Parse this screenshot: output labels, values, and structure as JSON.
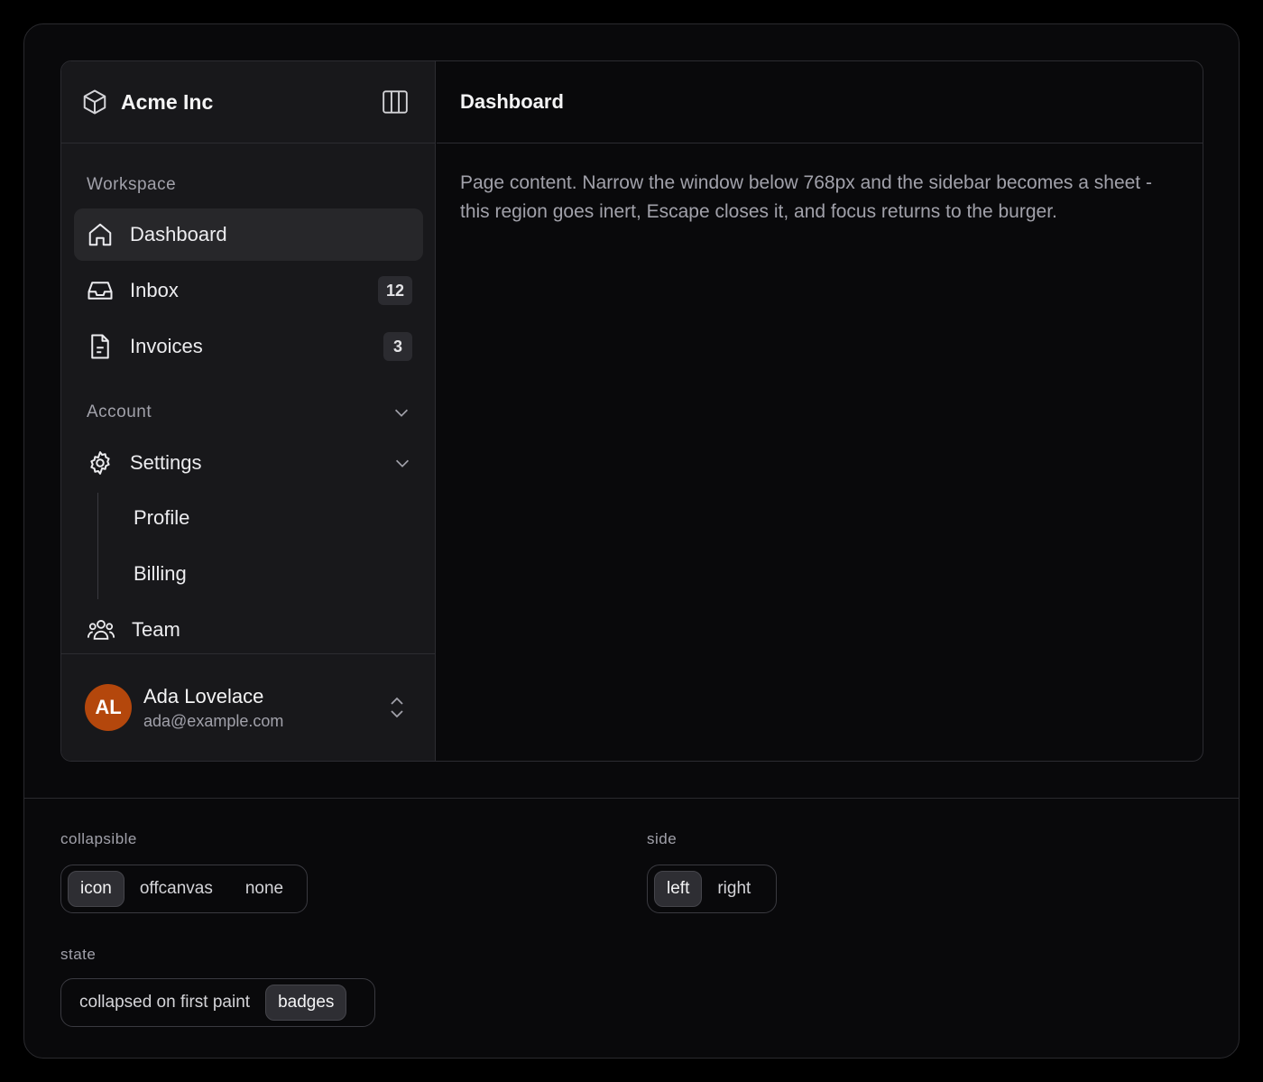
{
  "sidebar": {
    "brand": "Acme Inc",
    "workspace_label": "Workspace",
    "items": [
      {
        "label": "Dashboard",
        "icon": "home-icon"
      },
      {
        "label": "Inbox",
        "icon": "inbox-icon",
        "badge": "12"
      },
      {
        "label": "Invoices",
        "icon": "file-icon",
        "badge": "3"
      }
    ],
    "account_label": "Account",
    "settings": {
      "label": "Settings",
      "children": [
        "Profile",
        "Billing"
      ]
    },
    "team_label": "Team",
    "user": {
      "initials": "AL",
      "name": "Ada Lovelace",
      "email": "ada@example.com"
    }
  },
  "main": {
    "title": "Dashboard",
    "content": "Page content. Narrow the window below 768px and the sidebar becomes a sheet - this region goes inert, Escape closes it, and focus returns to the burger."
  },
  "controls": {
    "collapsible": {
      "label": "collapsible",
      "options": [
        "icon",
        "offcanvas",
        "none"
      ],
      "selected": "icon"
    },
    "side": {
      "label": "side",
      "options": [
        "left",
        "right"
      ],
      "selected": "left"
    },
    "state": {
      "label": "state",
      "options": [
        "collapsed on first paint",
        "badges"
      ],
      "selected": "badges"
    }
  },
  "colors": {
    "avatar": "#b4470c",
    "background": "#09090b",
    "sidebar": "#18181b"
  }
}
